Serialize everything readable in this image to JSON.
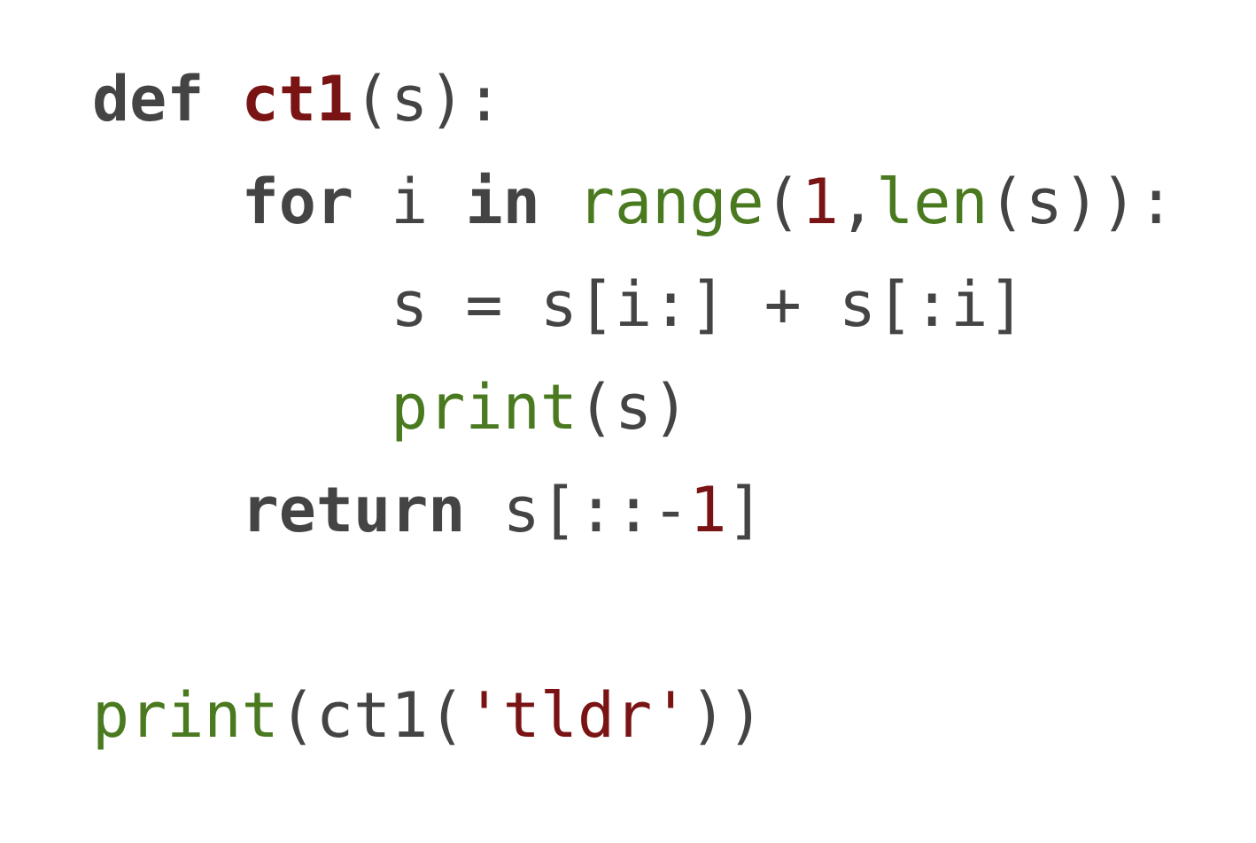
{
  "colors": {
    "default": "#444444",
    "keyword": "#444444",
    "builtin": "#4a7a1f",
    "literal": "#7a1414"
  },
  "code": {
    "lines": [
      {
        "tokens": [
          {
            "text": "def",
            "type": "keyword"
          },
          {
            "text": " ",
            "type": "default"
          },
          {
            "text": "ct1",
            "type": "fn-def"
          },
          {
            "text": "(s):",
            "type": "default"
          }
        ]
      },
      {
        "tokens": [
          {
            "text": "    ",
            "type": "default"
          },
          {
            "text": "for",
            "type": "keyword"
          },
          {
            "text": " i ",
            "type": "default"
          },
          {
            "text": "in",
            "type": "keyword"
          },
          {
            "text": " ",
            "type": "default"
          },
          {
            "text": "range",
            "type": "builtin"
          },
          {
            "text": "(",
            "type": "default"
          },
          {
            "text": "1",
            "type": "literal"
          },
          {
            "text": ",",
            "type": "default"
          },
          {
            "text": "len",
            "type": "builtin"
          },
          {
            "text": "(s)):",
            "type": "default"
          }
        ]
      },
      {
        "tokens": [
          {
            "text": "        s = s[i:] + s[:i]",
            "type": "default"
          }
        ]
      },
      {
        "tokens": [
          {
            "text": "        ",
            "type": "default"
          },
          {
            "text": "print",
            "type": "builtin"
          },
          {
            "text": "(s)",
            "type": "default"
          }
        ]
      },
      {
        "tokens": [
          {
            "text": "    ",
            "type": "default"
          },
          {
            "text": "return",
            "type": "keyword"
          },
          {
            "text": " s[::-",
            "type": "default"
          },
          {
            "text": "1",
            "type": "literal"
          },
          {
            "text": "]",
            "type": "default"
          }
        ]
      },
      {
        "tokens": []
      },
      {
        "tokens": [
          {
            "text": "print",
            "type": "builtin"
          },
          {
            "text": "(ct1(",
            "type": "default"
          },
          {
            "text": "'tldr'",
            "type": "literal"
          },
          {
            "text": "))",
            "type": "default"
          }
        ]
      }
    ]
  }
}
